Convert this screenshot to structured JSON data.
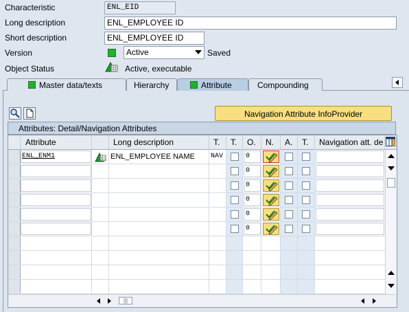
{
  "form": {
    "characteristic_label": "Characteristic",
    "characteristic_value": "ENL_EID",
    "long_desc_label": "Long description",
    "long_desc_value": "ENL_EMPLOYEE ID",
    "short_desc_label": "Short description",
    "short_desc_value": "ENL_EMPLOYEE ID",
    "version_label": "Version",
    "version_value": "Active",
    "version_status": "Saved",
    "object_status_label": "Object Status",
    "object_status_value": "Active, executable"
  },
  "tabs": [
    {
      "label": "Master data/texts",
      "icon": "green-square-icon"
    },
    {
      "label": "Hierarchy"
    },
    {
      "label": "Attribute",
      "icon": "green-square-icon",
      "active": true
    },
    {
      "label": "Compounding"
    }
  ],
  "toolbar": {
    "nav_infoprovider_label": "Navigation Attribute InfoProvider"
  },
  "grid": {
    "title": "Attributes: Detail/Navigation Attributes",
    "columns": [
      "Attribute",
      "Long description",
      "T.",
      "T.",
      "O.",
      "N.",
      "A.",
      "T.",
      "Navigation att. de"
    ],
    "rows": [
      {
        "attribute": "ENL_ENM1",
        "long_description": "ENL_EMPLOYEE NAME",
        "type": "NAV",
        "order": "0"
      },
      {
        "attribute": "",
        "long_description": "",
        "type": "",
        "order": "0"
      },
      {
        "attribute": "",
        "long_description": "",
        "type": "",
        "order": "0"
      },
      {
        "attribute": "",
        "long_description": "",
        "type": "",
        "order": "0"
      },
      {
        "attribute": "",
        "long_description": "",
        "type": "",
        "order": "0"
      },
      {
        "attribute": "",
        "long_description": "",
        "type": "",
        "order": "0"
      }
    ]
  },
  "colors": {
    "background": "#dfe6ef",
    "active_green": "#19b62b",
    "nav_button": "#f7df80",
    "selected_border": "#d12a2a"
  }
}
